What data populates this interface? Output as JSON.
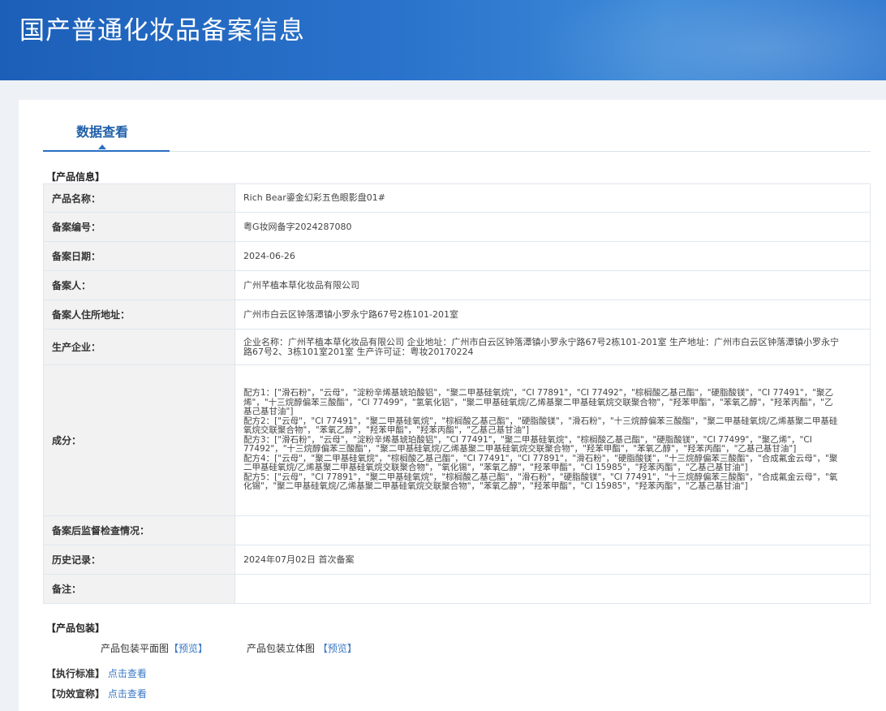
{
  "header": {
    "title": "国产普通化妆品备案信息"
  },
  "tabs": [
    {
      "label": "数据查看"
    }
  ],
  "product_info": {
    "section_title": "【产品信息】",
    "rows": [
      {
        "key": "产品名称：",
        "value": "Rich Bear鎏金幻彩五色眼影盘01#"
      },
      {
        "key": "备案编号：",
        "value": "粤G妆网备字2024287080"
      },
      {
        "key": "备案日期：",
        "value": "2024-06-26"
      },
      {
        "key": "备案人：",
        "value": "广州芊植本草化妆品有限公司"
      },
      {
        "key": "备案人住所地址：",
        "value": "广州市白云区钟落潭镇小罗永宁路67号2栋101-201室"
      },
      {
        "key": "生产企业：",
        "value": "企业名称：广州芊植本草化妆品有限公司 企业地址：广州市白云区钟落潭镇小罗永宁路67号2栋101-201室 生产地址：广州市白云区钟落潭镇小罗永宁路67号2、3栋101室201室 生产许可证：粤妆20170224"
      },
      {
        "key": "成分：",
        "value": "配方1：[\"滑石粉\"，\"云母\"，\"淀粉辛烯基琥珀酸铝\"，\"聚二甲基硅氧烷\"，\"CI 77891\"，\"CI 77492\"，\"棕榈酸乙基己酯\"，\"硬脂酸镁\"，\"CI 77491\"，\"聚乙烯\"，\"十三烷醇偏苯三酸酯\"，\"CI 77499\"，\"氢氧化铝\"，\"聚二甲基硅氧烷/乙烯基聚二甲基硅氧烷交联聚合物\"，\"羟苯甲酯\"，\"苯氧乙醇\"，\"羟苯丙酯\"，\"乙基己基甘油\"]\n配方2：[\"云母\"，\"CI 77491\"，\"聚二甲基硅氧烷\"，\"棕榈酸乙基己酯\"，\"硬脂酸镁\"，\"滑石粉\"，\"十三烷醇偏苯三酸酯\"，\"聚二甲基硅氧烷/乙烯基聚二甲基硅氧烷交联聚合物\"，\"苯氧乙醇\"，\"羟苯甲酯\"，\"羟苯丙酯\"，\"乙基己基甘油\"]\n配方3：[\"滑石粉\"，\"云母\"，\"淀粉辛烯基琥珀酸铝\"，\"CI 77491\"，\"聚二甲基硅氧烷\"，\"棕榈酸乙基己酯\"，\"硬脂酸镁\"，\"CI 77499\"，\"聚乙烯\"，\"CI 77492\"，\"十三烷醇偏苯三酸酯\"，\"聚二甲基硅氧烷/乙烯基聚二甲基硅氧烷交联聚合物\"，\"羟苯甲酯\"，\"苯氧乙醇\"，\"羟苯丙酯\"，\"乙基己基甘油\"]\n配方4：[\"云母\"，\"聚二甲基硅氧烷\"，\"棕榈酸乙基己酯\"，\"CI 77491\"，\"CI 77891\"，\"滑石粉\"，\"硬脂酸镁\"，\"十三烷醇偏苯三酸酯\"，\"合成氟金云母\"，\"聚二甲基硅氧烷/乙烯基聚二甲基硅氧烷交联聚合物\"，\"氧化锡\"，\"苯氧乙醇\"，\"羟苯甲酯\"，\"CI 15985\"，\"羟苯丙酯\"，\"乙基己基甘油\"]\n配方5：[\"云母\"，\"CI 77891\"，\"聚二甲基硅氧烷\"，\"棕榈酸乙基己酯\"，\"滑石粉\"，\"硬脂酸镁\"，\"CI 77491\"，\"十三烷醇偏苯三酸酯\"，\"合成氟金云母\"，\"氧化锡\"，\"聚二甲基硅氧烷/乙烯基聚二甲基硅氧烷交联聚合物\"，\"苯氧乙醇\"，\"羟苯甲酯\"，\"CI 15985\"，\"羟苯丙酯\"，\"乙基己基甘油\"]"
      },
      {
        "key": "备案后监督检查情况：",
        "value": ""
      },
      {
        "key": "历史记录：",
        "value": "2024年07月02日 首次备案"
      },
      {
        "key": "备注：",
        "value": ""
      }
    ]
  },
  "packaging": {
    "section_title": "【产品包装】",
    "flat_label": "产品包装平面图",
    "flat_link": "【预览】",
    "solid_label": "产品包装立体图",
    "solid_link": "【预览】"
  },
  "standard": {
    "label": "【执行标准】",
    "link": "点击查看"
  },
  "claims": {
    "label": "【功效宣称】",
    "link": "点击查看"
  }
}
